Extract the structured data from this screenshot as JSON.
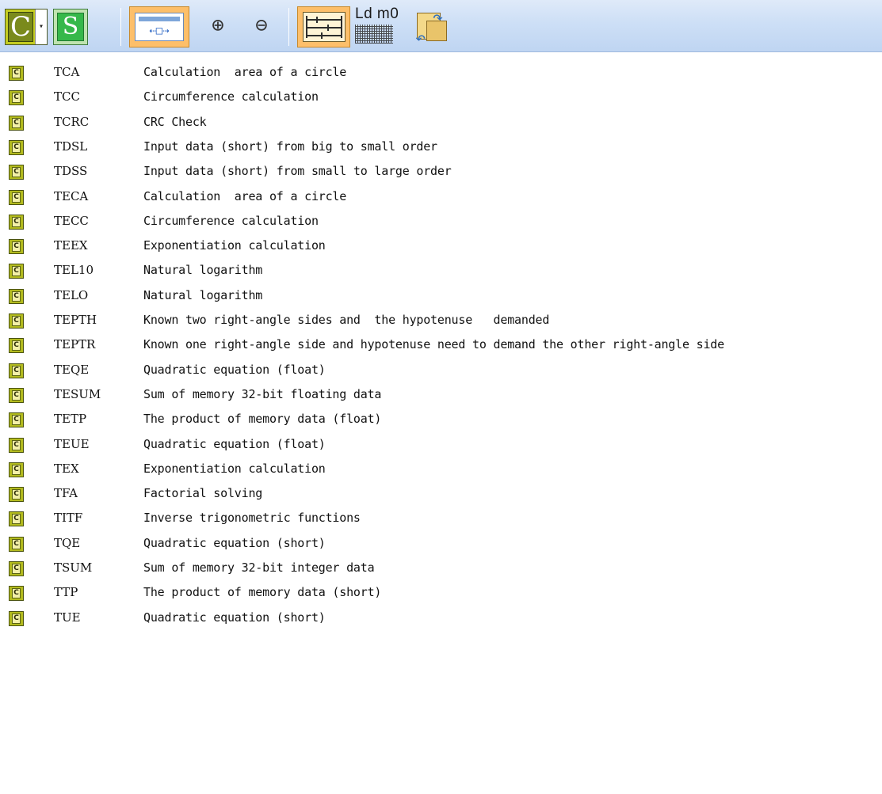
{
  "toolbar": {
    "c_button_label": "C",
    "dropdown_glyph": "▾",
    "s_button_label": "S",
    "fit_arrows": "⇠□⇢",
    "zoom_in_glyph": "⊕",
    "zoom_out_glyph": "⊖",
    "ladder_label": "Ld m0"
  },
  "instructions": [
    {
      "icon": "C",
      "code": "TCA",
      "description": "Calculation  area of a circle"
    },
    {
      "icon": "C",
      "code": "TCC",
      "description": "Circumference calculation"
    },
    {
      "icon": "C",
      "code": "TCRC",
      "description": "CRC Check"
    },
    {
      "icon": "C",
      "code": "TDSL",
      "description": "Input data (short) from big to small order"
    },
    {
      "icon": "C",
      "code": "TDSS",
      "description": "Input data (short) from small to large order"
    },
    {
      "icon": "C",
      "code": "TECA",
      "description": "Calculation  area of a circle"
    },
    {
      "icon": "C",
      "code": "TECC",
      "description": "Circumference calculation"
    },
    {
      "icon": "C",
      "code": "TEEX",
      "description": "Exponentiation calculation"
    },
    {
      "icon": "C",
      "code": "TEL10",
      "description": "Natural logarithm"
    },
    {
      "icon": "C",
      "code": "TELO",
      "description": "Natural logarithm"
    },
    {
      "icon": "C",
      "code": "TEPTH",
      "description": "Known two right-angle sides and  the hypotenuse   demanded"
    },
    {
      "icon": "C",
      "code": "TEPTR",
      "description": "Known one right-angle side and hypotenuse need to demand the other right-angle side"
    },
    {
      "icon": "C",
      "code": "TEQE",
      "description": "Quadratic equation (float)"
    },
    {
      "icon": "C",
      "code": "TESUM",
      "description": "Sum of memory 32-bit floating data"
    },
    {
      "icon": "C",
      "code": "TETP",
      "description": "The product of memory data (float)"
    },
    {
      "icon": "C",
      "code": "TEUE",
      "description": "Quadratic equation (float)"
    },
    {
      "icon": "C",
      "code": "TEX",
      "description": "Exponentiation calculation"
    },
    {
      "icon": "C",
      "code": "TFA",
      "description": "Factorial solving"
    },
    {
      "icon": "C",
      "code": "TITF",
      "description": "Inverse trigonometric functions"
    },
    {
      "icon": "C",
      "code": "TQE",
      "description": "Quadratic equation (short)"
    },
    {
      "icon": "C",
      "code": "TSUM",
      "description": "Sum of memory 32-bit integer data"
    },
    {
      "icon": "C",
      "code": "TTP",
      "description": "The product of memory data (short)"
    },
    {
      "icon": "C",
      "code": "TUE",
      "description": "Quadratic equation (short)"
    }
  ]
}
